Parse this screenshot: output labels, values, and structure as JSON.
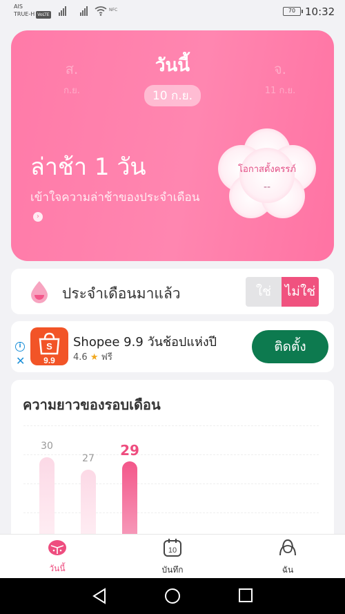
{
  "status_bar": {
    "carrier_line1": "AIS",
    "carrier_line2": "TRUE-H",
    "volte": "VoLTE",
    "nfc_label": "NFC",
    "battery": "70",
    "time": "10:32"
  },
  "date_selector": {
    "prev": {
      "day_name": "ส.",
      "date": "ก.ย."
    },
    "current": {
      "day_name": "วันนี้",
      "date": "10 ก.ย."
    },
    "next": {
      "day_name": "จ.",
      "date": "11 ก.ย."
    }
  },
  "hero": {
    "status": "ล่าช้า 1 วัน",
    "understand_link": "เข้าใจความล่าช้าของประจำเดือน",
    "pregnancy_label": "โอกาสตั้งครรภ์",
    "pregnancy_value": "--"
  },
  "period_card": {
    "label": "ประจำเดือนมาแล้ว",
    "yes": "ใช่",
    "no": "ไม่ใช่"
  },
  "ad": {
    "title": "Shopee 9.9 วันช้อปแห่งปี",
    "rating": "4.6",
    "price": "ฟรี",
    "install": "ติดตั้ง",
    "logo_text": "9.9",
    "logo_letter": "S"
  },
  "cycle_card": {
    "title": "ความยาวของรอบเดือน"
  },
  "chart_data": {
    "type": "bar",
    "title": "ความยาวของรอบเดือน",
    "values": [
      30,
      27,
      29
    ],
    "highlight_index": 2,
    "colors": {
      "normal": "#fcd9e6",
      "current": "#f3578a"
    }
  },
  "bottom_nav": {
    "items": [
      {
        "label": "วันนี้",
        "icon": "today-icon",
        "active": true
      },
      {
        "label": "บันทึก",
        "icon": "calendar-icon",
        "active": false,
        "icon_text": "10"
      },
      {
        "label": "ฉัน",
        "icon": "profile-icon",
        "active": false
      }
    ]
  },
  "colors": {
    "accent": "#ee4d7f",
    "hero": "#ff80ac",
    "install_button": "#0d7a4f"
  }
}
